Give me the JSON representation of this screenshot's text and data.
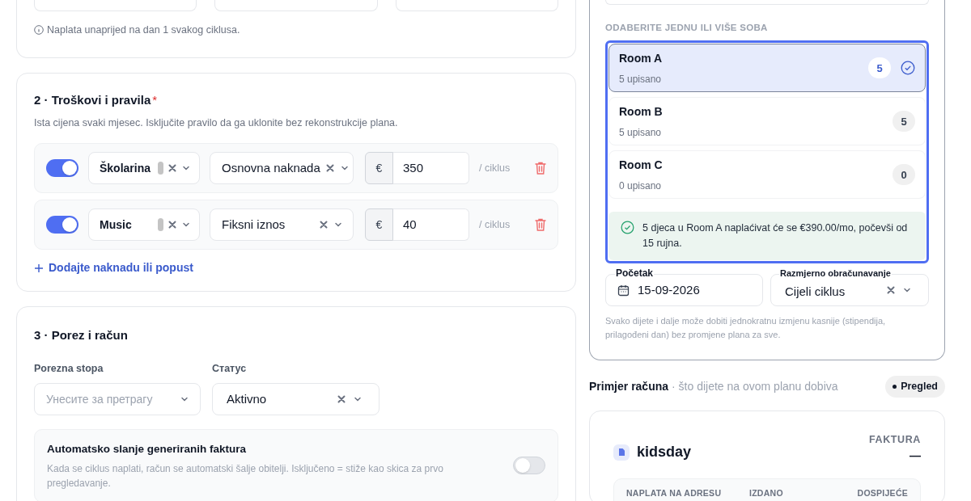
{
  "billing_note": "Naplata unaprijed na dan 1 svakog ciklusa.",
  "fees": {
    "title": "2 · Troškovi i pravila",
    "required_mark": "*",
    "description": "Ista cijena svaki mjesec. Isključite pravilo da ga uklonite bez rekonstrukcije plana.",
    "rules": [
      {
        "enabled": true,
        "category": "Školarina",
        "type": "Osnovna naknada",
        "currency": "€",
        "amount": "350",
        "period": "/ ciklus"
      },
      {
        "enabled": true,
        "category": "Music",
        "type": "Fiksni iznos",
        "currency": "€",
        "amount": "40",
        "period": "/ ciklus"
      }
    ],
    "add_link": "Dodajte naknadu ili popust"
  },
  "tax": {
    "title": "3 · Porez i račun",
    "tax_rate": {
      "label": "Porezna stopa",
      "placeholder": "Унесите за претрагу"
    },
    "status": {
      "label": "Статус",
      "value": "Aktivno"
    },
    "auto_send": {
      "title": "Automatsko slanje generiranih faktura",
      "description": "Kada se ciklus naplati, račun se automatski šalje obitelji. Isključeno = stiže kao skica za prvo pregledavanje.",
      "on": false
    }
  },
  "rooms": {
    "heading": "ODABERITE JEDNU ILI VIŠE SOBA",
    "items": [
      {
        "name": "Room A",
        "enrolled": "5 upisano",
        "count": "5",
        "selected": true
      },
      {
        "name": "Room B",
        "enrolled": "5 upisano",
        "count": "5",
        "selected": false
      },
      {
        "name": "Room C",
        "enrolled": "0 upisano",
        "count": "0",
        "selected": false
      }
    ],
    "summary": "5 djeca u Room A naplaćivat će se €390.00/mo, počevši od 15 rujna."
  },
  "start": {
    "label": "Početak",
    "value": "15-09-2026"
  },
  "proration": {
    "label": "Razmjerno obračunavanje",
    "value": "Cijeli ciklus"
  },
  "override_note": "Svako dijete i dalje može dobiti jednokratnu izmjenu kasnije (stipendija, prilagođeni dan) bez promjene plana za sve.",
  "invoice_preview": {
    "title": "Primjer računa",
    "subtitle": "· što dijete na ovom planu dobiva",
    "badge": "Pregled",
    "brand": "kidsday",
    "doc_label": "FAKTURA",
    "number": "—",
    "columns": [
      "NAPLATA NA ADRESU",
      "IZDANO",
      "DOSPIJEĆE"
    ]
  }
}
